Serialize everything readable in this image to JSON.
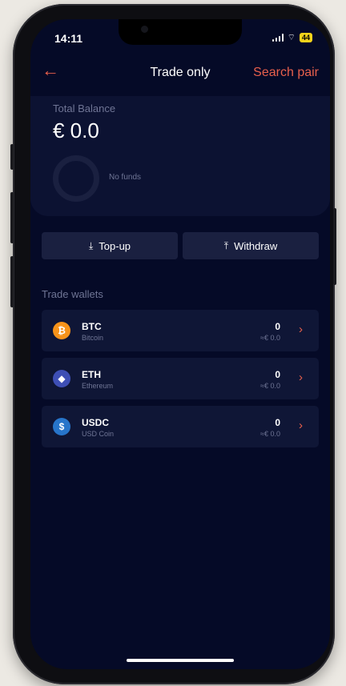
{
  "status_bar": {
    "time": "14:11",
    "battery": "44"
  },
  "nav": {
    "back_icon": "arrow-left-icon",
    "title": "Trade only",
    "search_label": "Search pair"
  },
  "balance": {
    "label": "Total Balance",
    "value": "€ 0.0",
    "empty_text": "No funds"
  },
  "actions": {
    "topup_label": "Top-up",
    "withdraw_label": "Withdraw"
  },
  "wallets": {
    "section_label": "Trade wallets",
    "items": [
      {
        "symbol": "BTC",
        "name": "Bitcoin",
        "amount": "0",
        "fiat": "≈€ 0.0",
        "icon": "bitcoin-icon",
        "color": "#f7931a",
        "glyph": "₿"
      },
      {
        "symbol": "ETH",
        "name": "Ethereum",
        "amount": "0",
        "fiat": "≈€ 0.0",
        "icon": "ethereum-icon",
        "color": "#3e4fb5",
        "glyph": "◆"
      },
      {
        "symbol": "USDC",
        "name": "USD Coin",
        "amount": "0",
        "fiat": "≈€ 0.0",
        "icon": "usdc-icon",
        "color": "#2775ca",
        "glyph": "$"
      }
    ]
  },
  "colors": {
    "background": "#050a27",
    "accent": "#e8604c",
    "card": "#0c1232"
  }
}
